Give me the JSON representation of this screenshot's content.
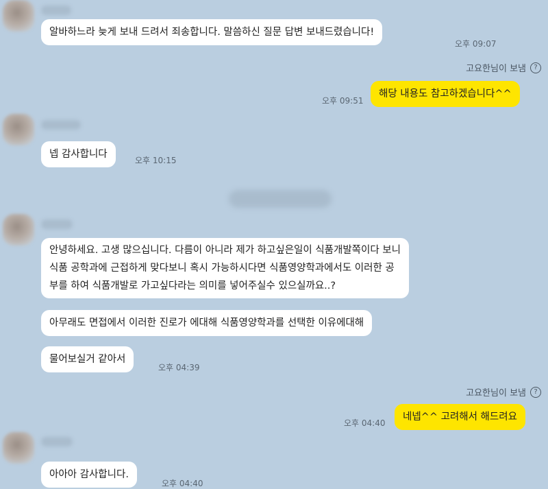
{
  "messages": {
    "m1": {
      "text": "알바하느라 늦게 보내 드려서 죄송합니다. 말씀하신 질문 답변 보내드렸습니다!",
      "time": "오후 09:07"
    },
    "sent1": {
      "label": "고요한님이 보냄"
    },
    "m2": {
      "text": "해당 내용도 참고하겠습니다^^",
      "time": "오후 09:51"
    },
    "m3": {
      "text": "넵 감사합니다",
      "time": "오후 10:15"
    },
    "m4": {
      "lines": [
        "안녕하세요. 고생 많으십니다. 다름이 아니라 제가 하고싶은일이 식품개발쪽이다 보니",
        "식품 공학과에 근접하게 맞다보니 혹시 가능하시다면 식품영양학과에서도 이러한 공",
        "부를 하여 식품개발로 가고싶다라는 의미를 넣어주실수 있으실까요..?"
      ]
    },
    "m5": {
      "text": "아무래도 면접에서 이러한 진로가 에대해 식품영양학과를 선택한 이유에대해"
    },
    "m6": {
      "text": "물어보실거 같아서",
      "time": "오후 04:39"
    },
    "sent2": {
      "label": "고요한님이 보냄"
    },
    "m7": {
      "text": "네넵^^ 고려해서 해드려요",
      "time": "오후 04:40"
    },
    "m8": {
      "text": "아아아 감사합니다.",
      "time": "오후 04:40"
    }
  },
  "icons": {
    "help": "question-circle-icon"
  },
  "colors": {
    "background": "#bacee0",
    "incoming": "#ffffff",
    "outgoing": "#fee500"
  }
}
